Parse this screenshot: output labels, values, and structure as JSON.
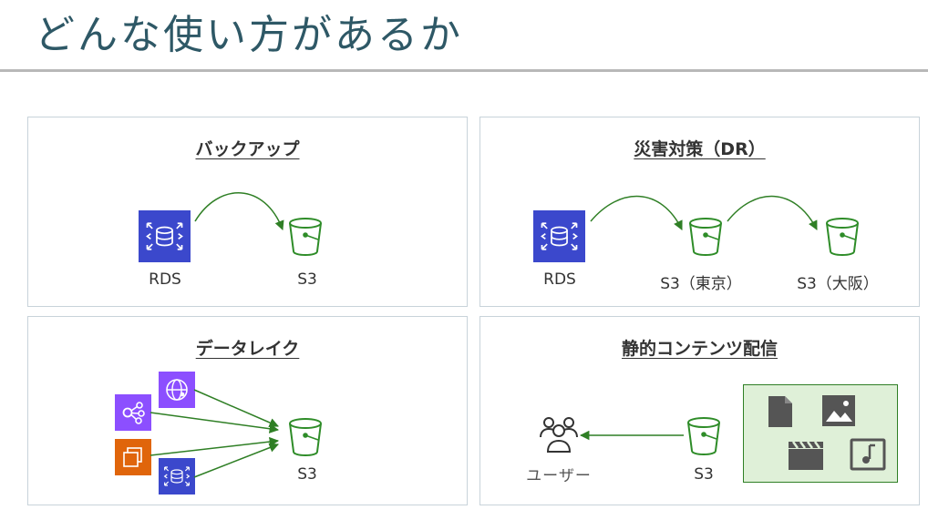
{
  "title": "どんな使い方があるか",
  "colors": {
    "title": "#2e5866",
    "database_blue": "#3b48cc",
    "analytics_purple": "#8c4fff",
    "compute_orange": "#e0650b",
    "s3_green": "#2e8c28",
    "arrow_green": "#2f7f25",
    "content_fill": "#dff0d8",
    "content_border": "#2f7f25"
  },
  "panels": {
    "backup": {
      "title": "バックアップ",
      "source_label": "RDS",
      "target_label": "S3",
      "icons": [
        "rds-icon",
        "s3-bucket-icon"
      ]
    },
    "dr": {
      "title": "災害対策（DR）",
      "source_label": "RDS",
      "tokyo_label": "S3（東京）",
      "osaka_label": "S3（大阪）",
      "icons": [
        "rds-icon",
        "s3-bucket-icon",
        "s3-bucket-icon"
      ]
    },
    "datalake": {
      "title": "データレイク",
      "target_label": "S3",
      "sources": [
        "cloudfront-icon",
        "network-service-icon",
        "ec2-icon",
        "rds-icon"
      ]
    },
    "static": {
      "title": "静的コンテンツ配信",
      "user_label": "ユーザー",
      "s3_label": "S3",
      "content_icons": [
        "document-icon",
        "image-icon",
        "video-icon",
        "music-icon"
      ]
    }
  }
}
